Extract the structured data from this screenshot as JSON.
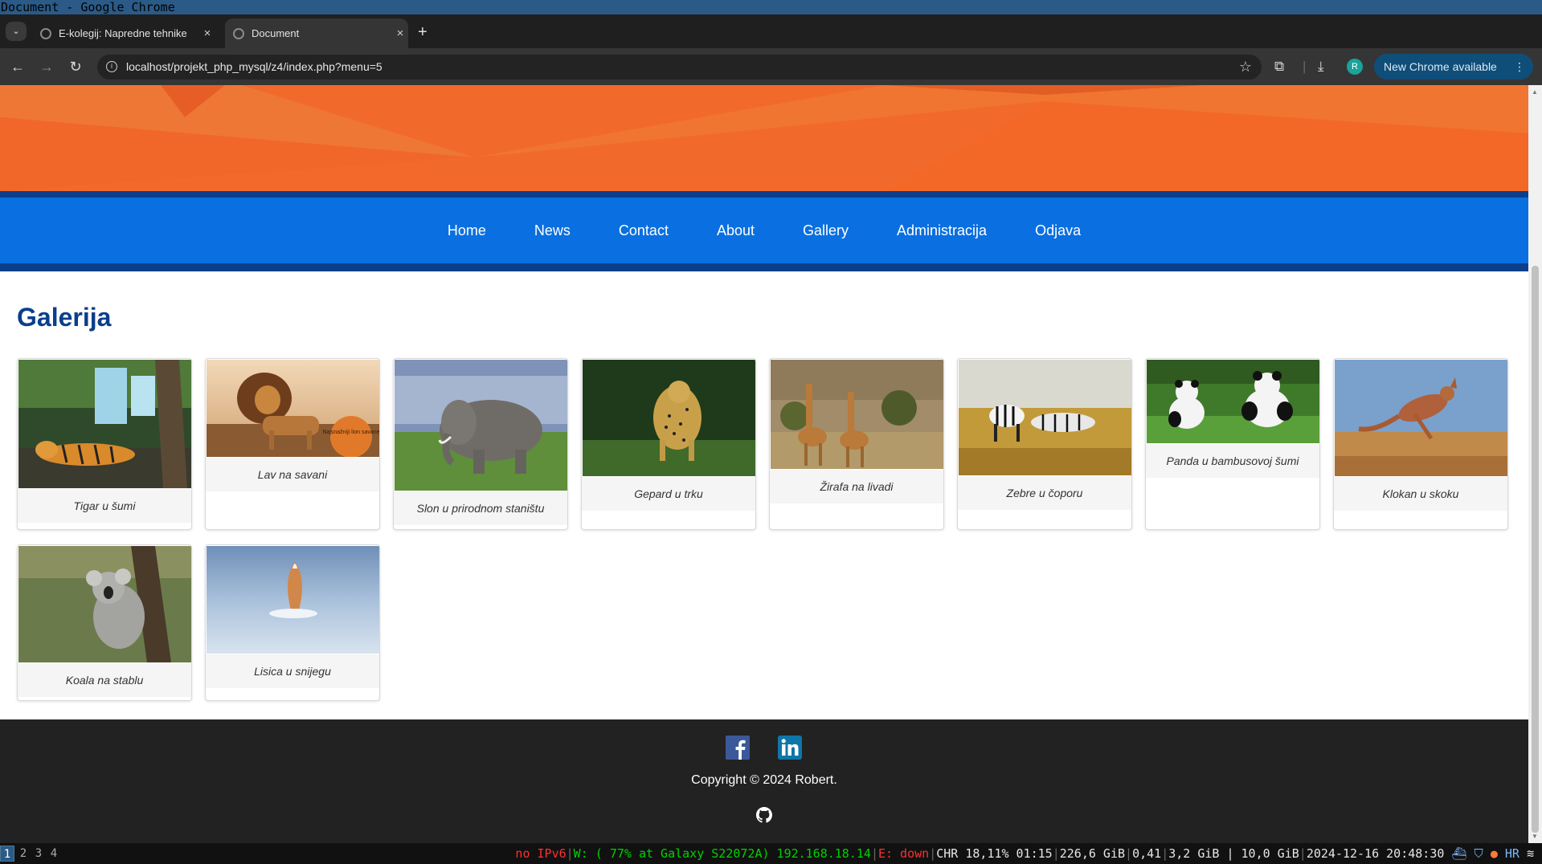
{
  "window": {
    "title": "Document - Google Chrome"
  },
  "tabs": [
    {
      "label": "E-kolegij: Napredne tehnike",
      "active": false
    },
    {
      "label": "Document",
      "active": true
    }
  ],
  "toolbar": {
    "url": "localhost/projekt_php_mysql/z4/index.php?menu=5",
    "profile_initial": "R",
    "update_label": "New Chrome available"
  },
  "colors": {
    "hero_orange": "#f26a2b",
    "nav_blue": "#0a6fe0",
    "nav_border": "#0b3f8a",
    "footer_bg": "#222222"
  },
  "nav": {
    "items": [
      {
        "label": "Home"
      },
      {
        "label": "News"
      },
      {
        "label": "Contact"
      },
      {
        "label": "About"
      },
      {
        "label": "Gallery"
      },
      {
        "label": "Administracija"
      },
      {
        "label": "Odjava"
      }
    ]
  },
  "gallery": {
    "title": "Galerija",
    "items": [
      {
        "caption": "Tigar u šumi",
        "icon": "tiger-photo"
      },
      {
        "caption": "Lav na savani",
        "icon": "lion-photo",
        "overlay_text": "Najsnažniji lion savane"
      },
      {
        "caption": "Slon u prirodnom staništu",
        "icon": "elephant-photo"
      },
      {
        "caption": "Gepard u trku",
        "icon": "cheetah-photo"
      },
      {
        "caption": "Žirafa na livadi",
        "icon": "giraffe-photo"
      },
      {
        "caption": "Zebre u čoporu",
        "icon": "zebra-photo"
      },
      {
        "caption": "Panda u bambusovoj šumi",
        "icon": "panda-photo"
      },
      {
        "caption": "Klokan u skoku",
        "icon": "kangaroo-photo"
      },
      {
        "caption": "Koala na stablu",
        "icon": "koala-photo"
      },
      {
        "caption": "Lisica u snijegu",
        "icon": "fox-photo"
      }
    ]
  },
  "footer": {
    "copyright": "Copyright © 2024 Robert.",
    "social": [
      "facebook-icon",
      "linkedin-icon",
      "github-icon"
    ]
  },
  "statusbar": {
    "workspaces": [
      "1",
      "2",
      "3",
      "4"
    ],
    "active_workspace": "1",
    "ipv6": "no IPv6",
    "wifi": "W: ( 77% at Galaxy S22072A) 192.168.18.14",
    "ethernet": "E: down",
    "cpu": "CHR 18,11% 01:15",
    "disk": "226,6 GiB",
    "load": "0,41",
    "memory": "3,2 GiB | 10,0 GiB",
    "datetime": "2024-12-16 20:48:30",
    "layout": "HR"
  }
}
